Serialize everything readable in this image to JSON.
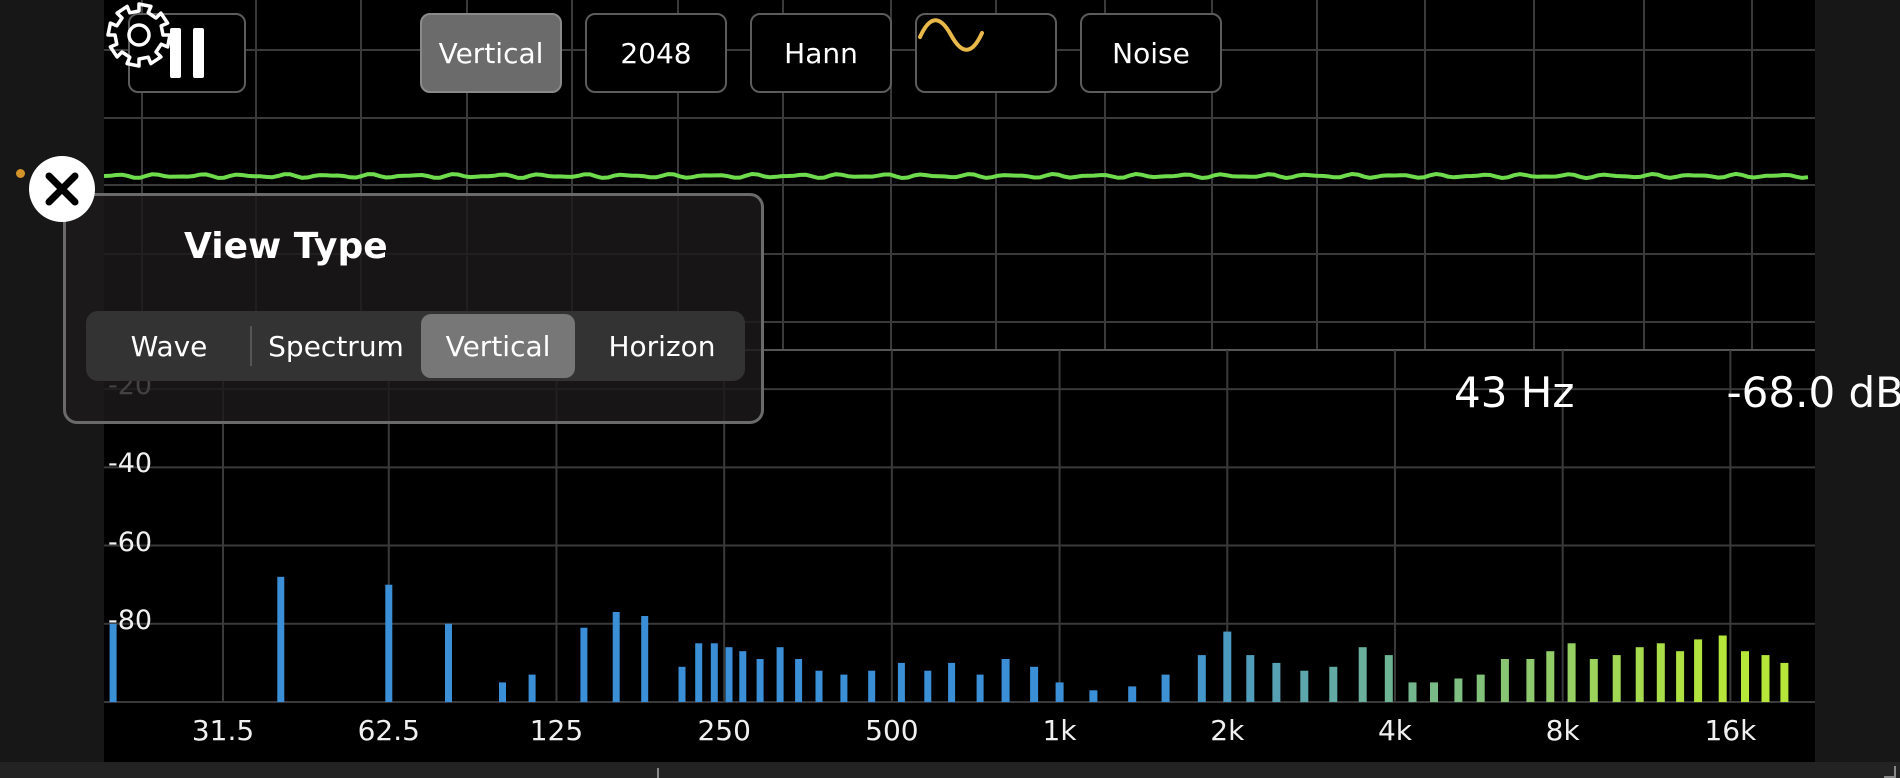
{
  "toolbar": {
    "pause_icon": "pause-icon",
    "view_label": "Vertical",
    "fft_label": "2048",
    "window_label": "Hann",
    "signal_icon": "sine-wave-icon",
    "noise_label": "Noise",
    "settings_icon": "gear-icon"
  },
  "readout": {
    "frequency": "43 Hz",
    "level": "-68.0 dB"
  },
  "popup": {
    "title": "View Type",
    "options": [
      "Wave",
      "Spectrum",
      "Vertical",
      "Horizon"
    ],
    "selected": "Vertical",
    "close_icon": "close-icon"
  },
  "colors": {
    "waveform": "#6fdc4e",
    "spectrum_low": "#3b8fd6",
    "spectrum_high": "#b6e63a",
    "accent": "#e9b84a"
  },
  "chart_data": {
    "type": "bar",
    "xscale": "log",
    "xticks": [
      "31.5",
      "62.5",
      "125",
      "250",
      "500",
      "1k",
      "2k",
      "4k",
      "8k",
      "16k"
    ],
    "yticks": [
      "-20",
      "-40",
      "-60",
      "-80"
    ],
    "ylim": [
      -100,
      -10
    ],
    "series": [
      {
        "values": [
          [
            20,
            -80
          ],
          [
            40,
            -68
          ],
          [
            62.5,
            -70
          ],
          [
            80,
            -80
          ],
          [
            100,
            -95
          ],
          [
            113,
            -93
          ],
          [
            140,
            -81
          ],
          [
            160,
            -77
          ],
          [
            180,
            -78
          ],
          [
            210,
            -91
          ],
          [
            225,
            -85
          ],
          [
            240,
            -85
          ],
          [
            255,
            -86
          ],
          [
            270,
            -87
          ],
          [
            290,
            -89
          ],
          [
            315,
            -86
          ],
          [
            340,
            -89
          ],
          [
            370,
            -92
          ],
          [
            410,
            -93
          ],
          [
            460,
            -92
          ],
          [
            520,
            -90
          ],
          [
            580,
            -92
          ],
          [
            640,
            -90
          ],
          [
            720,
            -93
          ],
          [
            800,
            -89
          ],
          [
            900,
            -91
          ],
          [
            1000,
            -95
          ],
          [
            1150,
            -97
          ],
          [
            1350,
            -96
          ],
          [
            1550,
            -93
          ],
          [
            1800,
            -88
          ],
          [
            2000,
            -82
          ],
          [
            2200,
            -88
          ],
          [
            2450,
            -90
          ],
          [
            2750,
            -92
          ],
          [
            3100,
            -91
          ],
          [
            3500,
            -86
          ],
          [
            3900,
            -88
          ],
          [
            4300,
            -95
          ],
          [
            4700,
            -95
          ],
          [
            5200,
            -94
          ],
          [
            5700,
            -93
          ],
          [
            6300,
            -89
          ],
          [
            7000,
            -89
          ],
          [
            7600,
            -87
          ],
          [
            8300,
            -85
          ],
          [
            9100,
            -89
          ],
          [
            10000,
            -88
          ],
          [
            11000,
            -86
          ],
          [
            12000,
            -85
          ],
          [
            13000,
            -87
          ],
          [
            14000,
            -84
          ],
          [
            15500,
            -83
          ],
          [
            17000,
            -87
          ],
          [
            18500,
            -88
          ],
          [
            20000,
            -90
          ]
        ]
      }
    ]
  }
}
